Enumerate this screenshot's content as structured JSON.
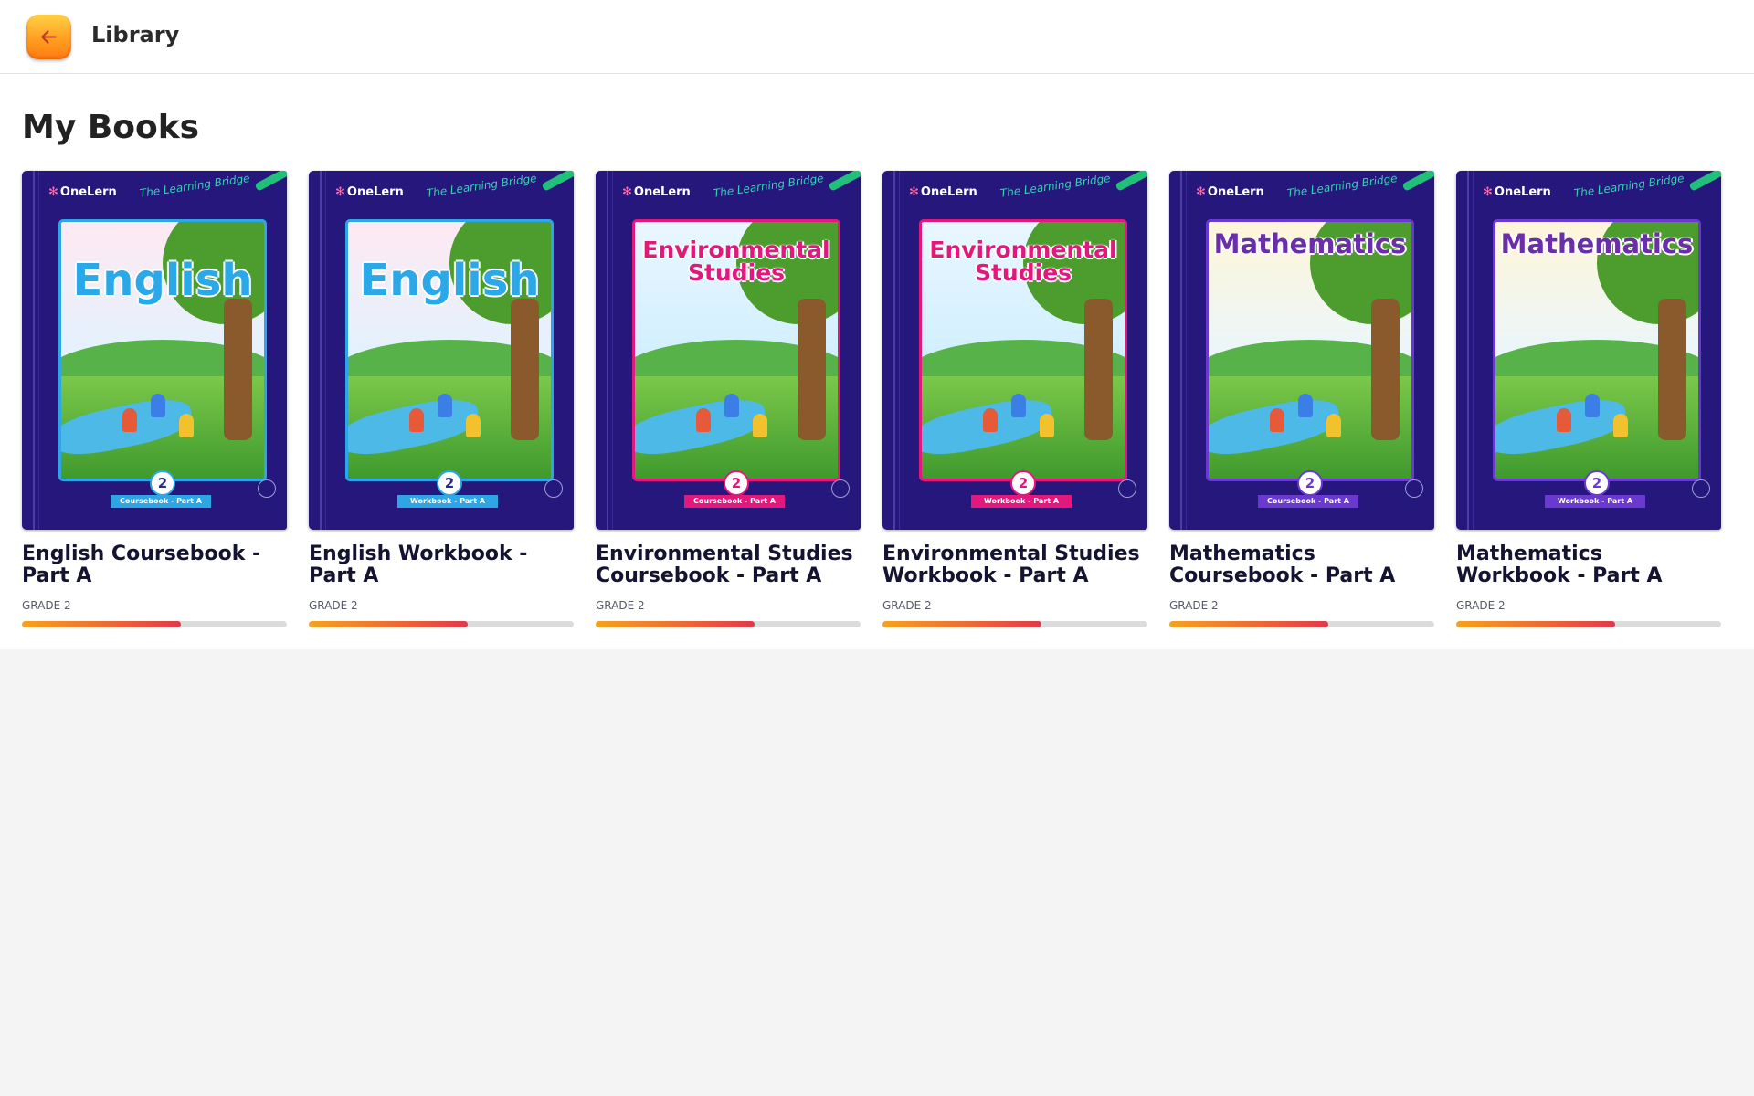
{
  "header": {
    "back_icon": "arrow-left-icon",
    "title": "Library"
  },
  "section": {
    "title": "My Books"
  },
  "books": [
    {
      "title": "English Coursebook - Part A",
      "grade": "GRADE 2",
      "cover": {
        "brand": "OneLern",
        "tagline": "The Learning Bridge",
        "subject": "English",
        "grade_number": "2",
        "type_label": "Coursebook - Part A",
        "theme": "blue"
      },
      "progress": 0.6
    },
    {
      "title": "English Workbook - Part A",
      "grade": "GRADE 2",
      "cover": {
        "brand": "OneLern",
        "tagline": "The Learning Bridge",
        "subject": "English",
        "grade_number": "2",
        "type_label": "Workbook - Part A",
        "theme": "blue"
      },
      "progress": 0.6
    },
    {
      "title": "Environmental Studies Coursebook - Part A",
      "grade": "GRADE 2",
      "cover": {
        "brand": "OneLern",
        "tagline": "The Learning Bridge",
        "subject": "Environmental Studies",
        "grade_number": "2",
        "type_label": "Coursebook - Part A",
        "theme": "pink"
      },
      "progress": 0.6
    },
    {
      "title": "Environmental Studies Workbook - Part A",
      "grade": "GRADE 2",
      "cover": {
        "brand": "OneLern",
        "tagline": "The Learning Bridge",
        "subject": "Environmental Studies",
        "grade_number": "2",
        "type_label": "Workbook - Part A",
        "theme": "pink"
      },
      "progress": 0.6
    },
    {
      "title": "Mathematics Coursebook - Part A",
      "grade": "GRADE 2",
      "cover": {
        "brand": "OneLern",
        "tagline": "The Learning Bridge",
        "subject": "Mathematics",
        "grade_number": "2",
        "type_label": "Coursebook - Part A",
        "theme": "violet"
      },
      "progress": 0.6
    },
    {
      "title": "Mathematics Workbook - Part A",
      "grade": "GRADE 2",
      "cover": {
        "brand": "OneLern",
        "tagline": "The Learning Bridge",
        "subject": "Mathematics",
        "grade_number": "2",
        "type_label": "Workbook - Part A",
        "theme": "violet"
      },
      "progress": 0.6
    }
  ],
  "colors": {
    "back_button": "#ff9f1f",
    "cover_background": "#26177d",
    "progress_start": "#f6a21c",
    "progress_end": "#e0394c",
    "page_background": "#f4f4f4"
  }
}
